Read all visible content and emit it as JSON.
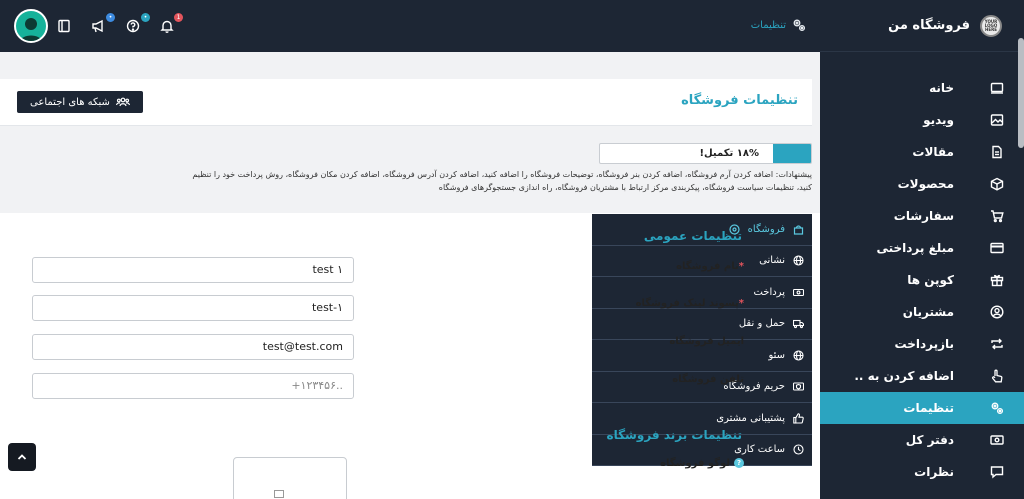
{
  "brand": {
    "name": "فروشگاه من",
    "logo_text": "YOUR LOGO HERE"
  },
  "breadcrumb": {
    "label": "تنظیمات"
  },
  "topbar": {
    "badges": {
      "megaphone": "•",
      "help": "•",
      "bell": "1"
    }
  },
  "sidebar": {
    "items": [
      {
        "label": "خانه",
        "icon": "home-icon"
      },
      {
        "label": "ویدیو",
        "icon": "image-icon"
      },
      {
        "label": "مقالات",
        "icon": "document-icon"
      },
      {
        "label": "محصولات",
        "icon": "box-icon"
      },
      {
        "label": "سفارشات",
        "icon": "cart-icon"
      },
      {
        "label": "مبلغ پرداختی",
        "icon": "credit-card-icon"
      },
      {
        "label": "کوپن ها",
        "icon": "gift-icon"
      },
      {
        "label": "مشتریان",
        "icon": "user-icon"
      },
      {
        "label": "بازپرداخت",
        "icon": "refund-icon"
      },
      {
        "label": "اضافه کردن به ..",
        "icon": "hand-pointer-icon"
      },
      {
        "label": "تنظیمات",
        "icon": "gears-icon",
        "active": true
      },
      {
        "label": "دفتر کل",
        "icon": "money-icon"
      },
      {
        "label": "نظرات",
        "icon": "comment-icon"
      }
    ]
  },
  "header": {
    "title": "تنظیمات فروشگاه",
    "social_button": "شبکه های اجتماعی"
  },
  "progress": {
    "text": "۱۸% تکمیل!",
    "percent": 18
  },
  "suggestions": {
    "line1": "پیشنهادات: اضافه کردن آرم فروشگاه، اضافه کردن بنر فروشگاه، توضیحات فروشگاه را اضافه کنید، اضافه کردن آدرس فروشگاه، اضافه کردن مکان فروشگاه، روش پرداخت خود را تنظیم",
    "line2": "کنید، تنظیمات سیاست فروشگاه، پیکربندی مرکز ارتباط با مشتریان فروشگاه، راه اندازی جستجوگرهای فروشگاه"
  },
  "submenu": {
    "items": [
      {
        "label": "فروشگاه",
        "icon": "store-icon",
        "active": true
      },
      {
        "label": "نشانی",
        "icon": "globe-icon"
      },
      {
        "label": "پرداخت",
        "icon": "money-icon"
      },
      {
        "label": "حمل و نقل",
        "icon": "truck-icon"
      },
      {
        "label": "سئو",
        "icon": "globe-icon"
      },
      {
        "label": "حریم فروشگاه",
        "icon": "shield-icon"
      },
      {
        "label": "پشتیبانی مشتری",
        "icon": "thumbs-up-icon"
      },
      {
        "label": "ساعت کاری",
        "icon": "clock-icon"
      }
    ]
  },
  "form": {
    "general_title": "تنظیمات عمومی",
    "store_name": {
      "label": "نام فروشگاه",
      "required": "*",
      "value": "test ۱"
    },
    "store_slug": {
      "label": "پسوند لینک فروشگاه",
      "required": "*",
      "value": "test-۱"
    },
    "store_email": {
      "label": "ایمیل فروشگاه",
      "value": "test@test.com"
    },
    "store_phone": {
      "label": "تلفن فروشگاه",
      "placeholder": "+۱۲۳۴۵۶.."
    },
    "brand_title": "تنظیمات برند فروشگاه",
    "logo_label": "لوگو فروشگاه",
    "help_mark": "?"
  },
  "colors": {
    "accent": "#2ba4c0",
    "dark": "#1d2634"
  }
}
